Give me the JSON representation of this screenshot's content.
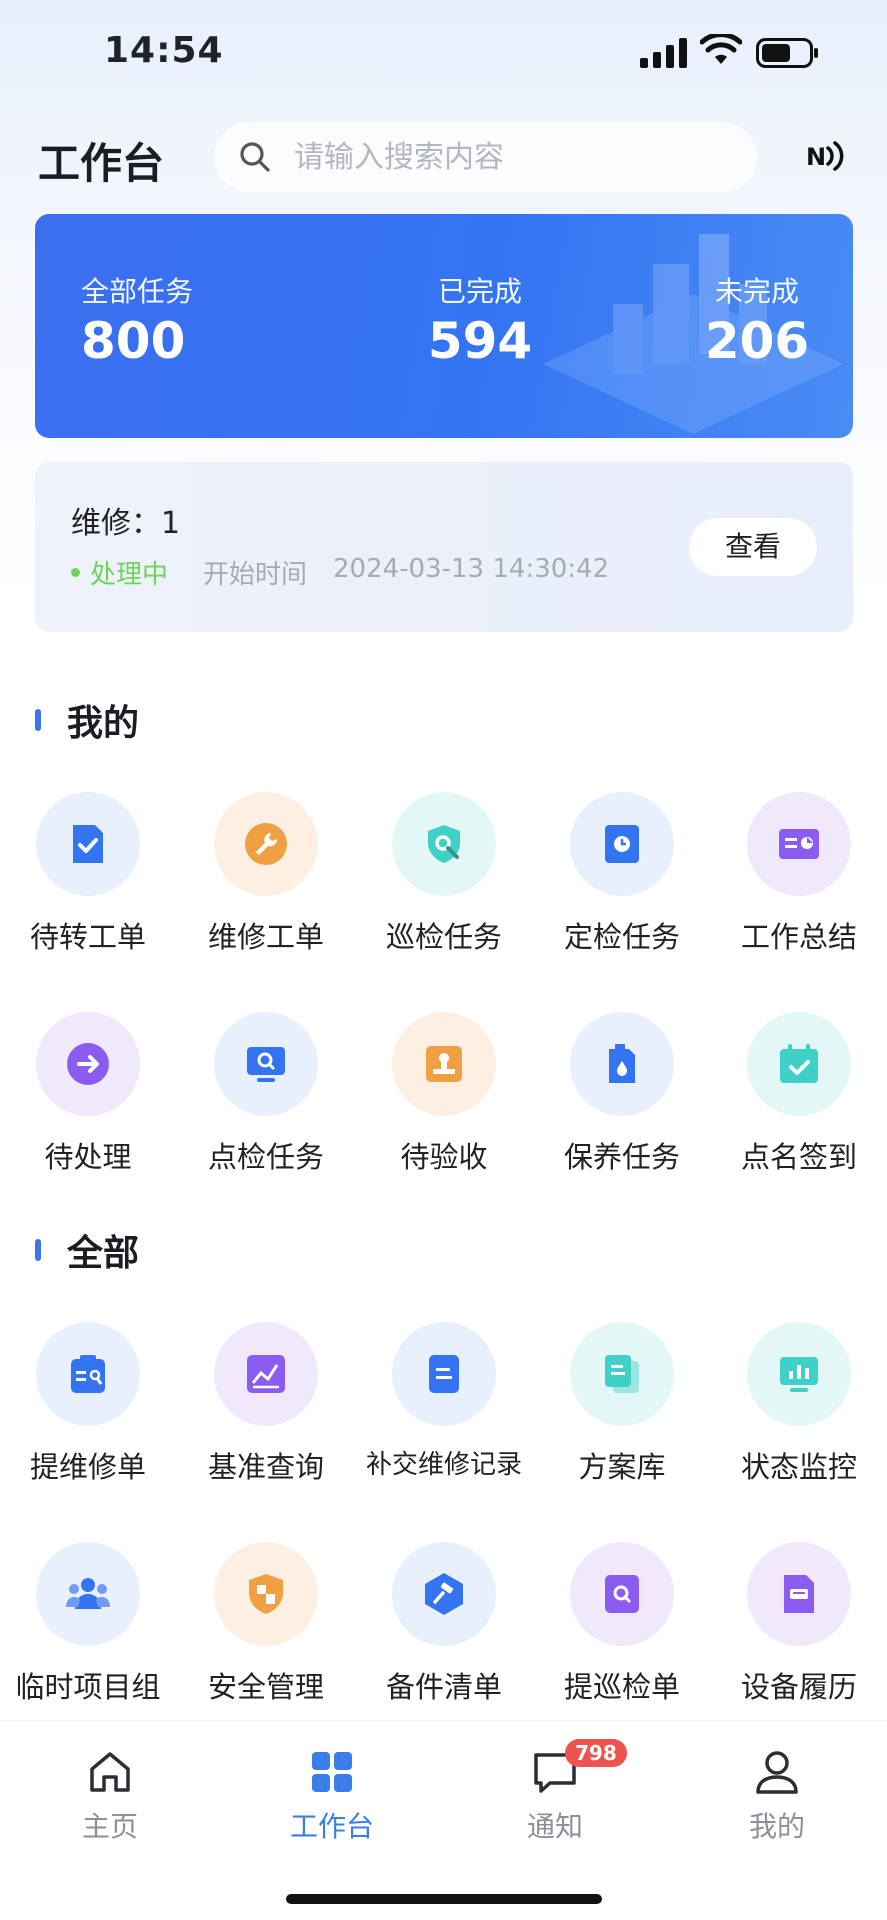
{
  "status_bar": {
    "time": "14:54"
  },
  "header": {
    "title": "工作台",
    "search_placeholder": "请输入搜索内容",
    "nfc_icon": "nfc-icon"
  },
  "stats": {
    "total_label": "全部任务",
    "total_value": "800",
    "done_label": "已完成",
    "done_value": "594",
    "undone_label": "未完成",
    "undone_value": "206"
  },
  "task": {
    "title": "维修：1",
    "status": "处理中",
    "time_label": "开始时间",
    "time_value": "2024-03-13 14:30:42",
    "view_button": "查看"
  },
  "sections": {
    "mine_title": "我的",
    "all_title": "全部"
  },
  "mine_items": [
    {
      "label": "待转工单",
      "icon": "doc-check-icon"
    },
    {
      "label": "维修工单",
      "icon": "wrench-icon"
    },
    {
      "label": "巡检任务",
      "icon": "shield-search-icon"
    },
    {
      "label": "定检任务",
      "icon": "clock-doc-icon"
    },
    {
      "label": "工作总结",
      "icon": "summary-card-icon"
    },
    {
      "label": "待处理",
      "icon": "arrow-right-icon"
    },
    {
      "label": "点检任务",
      "icon": "monitor-search-icon"
    },
    {
      "label": "待验收",
      "icon": "stamp-icon"
    },
    {
      "label": "保养任务",
      "icon": "oil-can-icon"
    },
    {
      "label": "点名签到",
      "icon": "calendar-check-icon"
    }
  ],
  "all_items": [
    {
      "label": "提维修单",
      "icon": "clipboard-wrench-icon"
    },
    {
      "label": "基准查询",
      "icon": "chart-icon"
    },
    {
      "label": "补交维修记录",
      "icon": "record-doc-icon"
    },
    {
      "label": "方案库",
      "icon": "stacked-docs-icon"
    },
    {
      "label": "状态监控",
      "icon": "monitor-bars-icon"
    },
    {
      "label": "临时项目组",
      "icon": "team-icon"
    },
    {
      "label": "安全管理",
      "icon": "security-shield-icon"
    },
    {
      "label": "备件清单",
      "icon": "hexagon-tool-icon"
    },
    {
      "label": "提巡检单",
      "icon": "search-doc-icon"
    },
    {
      "label": "设备履历",
      "icon": "device-card-icon"
    }
  ],
  "nav": {
    "home": "主页",
    "workbench": "工作台",
    "notice": "通知",
    "notice_badge": "798",
    "mine": "我的"
  },
  "colors": {
    "accent": "#3a74f1",
    "processing": "#6ed35a",
    "badge": "#ef5350"
  }
}
